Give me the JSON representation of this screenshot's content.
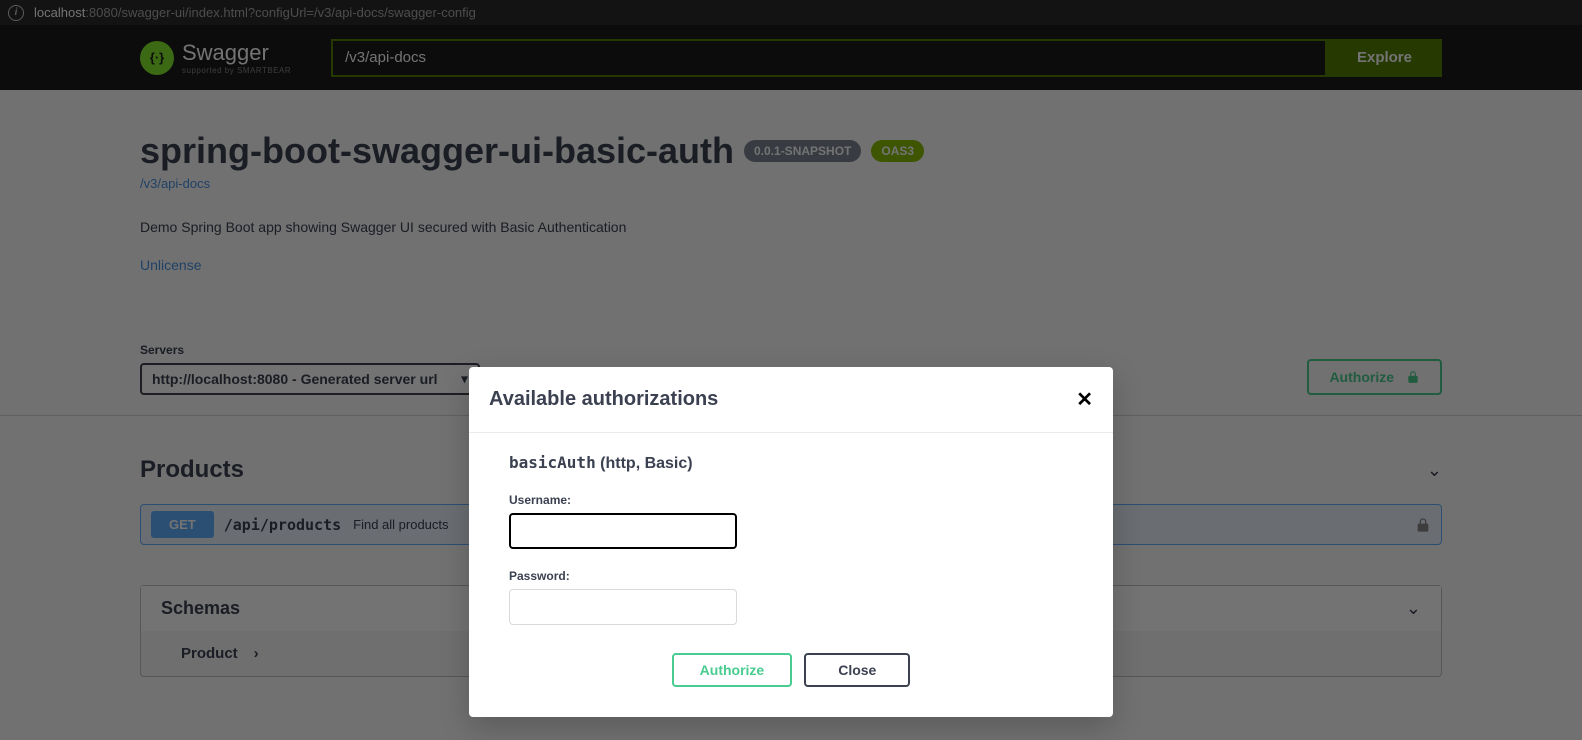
{
  "browser": {
    "url_host": "localhost",
    "url_rest": ":8080/swagger-ui/index.html?configUrl=/v3/api-docs/swagger-config"
  },
  "topbar": {
    "logo_text": "Swagger",
    "logo_sub": "supported by SMARTBEAR",
    "api_url_value": "/v3/api-docs",
    "explore_label": "Explore"
  },
  "info": {
    "title": "spring-boot-swagger-ui-basic-auth",
    "version": "0.0.1-SNAPSHOT",
    "oas": "OAS3",
    "link": "/v3/api-docs",
    "description": "Demo Spring Boot app showing Swagger UI secured with Basic Authentication",
    "license": "Unlicense"
  },
  "servers": {
    "label": "Servers",
    "selected": "http://localhost:8080 - Generated server url",
    "authorize_label": "Authorize"
  },
  "tags": [
    {
      "name": "Products",
      "operations": [
        {
          "method": "GET",
          "path": "/api/products",
          "summary": "Find all products"
        }
      ]
    }
  ],
  "schemas": {
    "title": "Schemas",
    "items": [
      "Product"
    ]
  },
  "modal": {
    "title": "Available authorizations",
    "auth_name": "basicAuth",
    "auth_type": "(http, Basic)",
    "username_label": "Username:",
    "password_label": "Password:",
    "authorize_label": "Authorize",
    "close_label": "Close"
  }
}
